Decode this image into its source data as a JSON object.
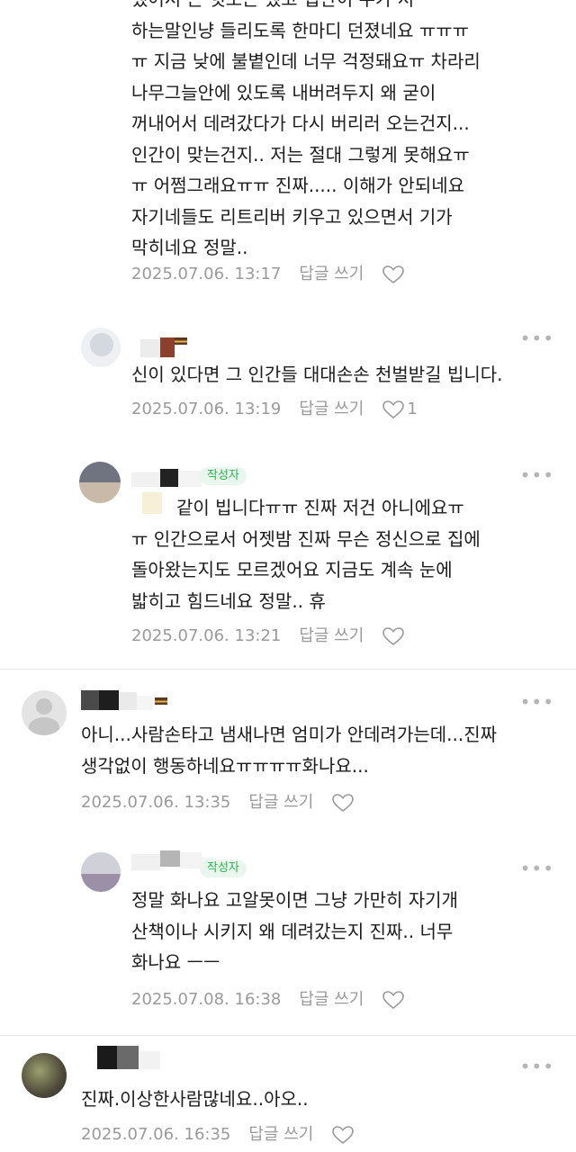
{
  "comments": [
    {
      "text": "했어서 곤 헛노는 했고 집안이 누가 서\n하는말인냥 들리도록 한마디 던졌네요 ㅠㅠㅠ\nㅠ 지금 낮에 불볕인데 너무 걱정돼요ㅠ 차라리\n나무그늘안에 있도록 내버려두지 왜 굳이\n꺼내어서 데려갔다가 다시 버리러 오는건지...\n인간이 맞는건지.. 저는 절대 그렇게 못해요ㅠ\nㅠ 어쩜그래요ㅠㅠ 진짜..... 이해가 안되네요\n자기네들도 리트리버 키우고 있으면서 기가\n막히네요 정말..",
      "date": "2025.07.06. 13:17",
      "reply": "답글 쓰기",
      "likes": ""
    },
    {
      "text": "신이 있다면 그 인간들 대대손손 천벌받길 빕니다.",
      "date": "2025.07.06. 13:19",
      "reply": "답글 쓰기",
      "likes": "1"
    },
    {
      "author_badge": "작성자",
      "text": "같이 빕니다ㅠㅠ 진짜 저건 아니에요ㅠ\nㅠ 인간으로서 어젯밤 진짜 무슨 정신으로 집에\n돌아왔는지도 모르겠어요 지금도 계속 눈에\n밟히고 힘드네요 정말.. 휴",
      "date": "2025.07.06. 13:21",
      "reply": "답글 쓰기",
      "likes": ""
    },
    {
      "text": "아니...사람손타고 냄새나면 엄미가 안데려가는데...진짜\n생각없이 행동하네요ㅠㅠㅠㅠ화나요...",
      "date": "2025.07.06. 13:35",
      "reply": "답글 쓰기",
      "likes": ""
    },
    {
      "author_badge": "작성자",
      "text": "정말 화나요 고알못이면 그냥 가만히 자기개\n산책이나 시키지 왜 데려갔는지 진짜.. 너무\n화나요 ㅡㅡ",
      "date": "2025.07.08. 16:38",
      "reply": "답글 쓰기",
      "likes": ""
    },
    {
      "text": "진짜.이상한사람많네요..아오..",
      "date": "2025.07.06. 16:35",
      "reply": "답글 쓰기",
      "likes": ""
    }
  ],
  "icons": {
    "more": "more-dots-icon",
    "like": "heart-outline-icon",
    "cake": "cake-badge-icon"
  },
  "colors": {
    "author_badge_text": "#2bb24c",
    "author_badge_bg": "#eaf7ee",
    "meta": "#9a9a9a"
  }
}
